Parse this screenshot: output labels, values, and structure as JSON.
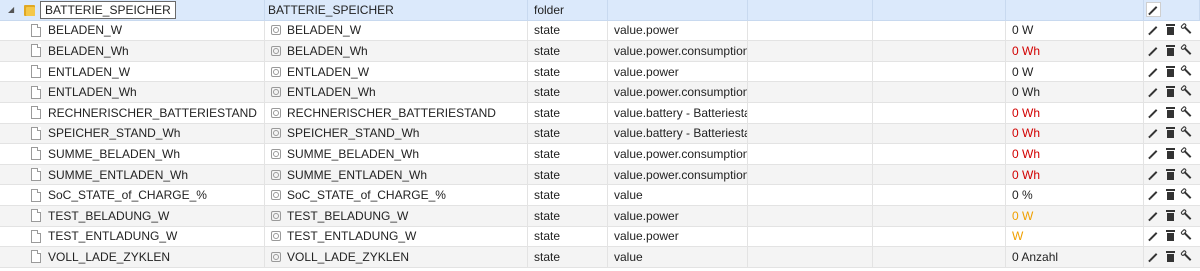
{
  "colors": {
    "selected_row": "#dbe9fb",
    "red_value": "#d20000",
    "orange_value": "#f0a000",
    "normal_value": "#222222"
  },
  "folder": {
    "id": "BATTERIE_SPEICHER",
    "name": "BATTERIE_SPEICHER",
    "type": "folder"
  },
  "rows": [
    {
      "id": "BELADEN_W",
      "name": "BELADEN_W",
      "type": "state",
      "role": "value.power",
      "value": "0 W",
      "value_color": "normal"
    },
    {
      "id": "BELADEN_Wh",
      "name": "BELADEN_Wh",
      "type": "state",
      "role": "value.power.consumption",
      "value": "0 Wh",
      "value_color": "red"
    },
    {
      "id": "ENTLADEN_W",
      "name": "ENTLADEN_W",
      "type": "state",
      "role": "value.power",
      "value": "0 W",
      "value_color": "normal"
    },
    {
      "id": "ENTLADEN_Wh",
      "name": "ENTLADEN_Wh",
      "type": "state",
      "role": "value.power.consumption",
      "value": "0 Wh",
      "value_color": "normal"
    },
    {
      "id": "RECHNERISCHER_BATTERIESTAND",
      "name": "RECHNERISCHER_BATTERIESTAND",
      "type": "state",
      "role": "value.battery - Batteriestar",
      "value": "0 Wh",
      "value_color": "red"
    },
    {
      "id": "SPEICHER_STAND_Wh",
      "name": "SPEICHER_STAND_Wh",
      "type": "state",
      "role": "value.battery - Batteriestar",
      "value": "0 Wh",
      "value_color": "red"
    },
    {
      "id": "SUMME_BELADEN_Wh",
      "name": "SUMME_BELADEN_Wh",
      "type": "state",
      "role": "value.power.consumption",
      "value": "0 Wh",
      "value_color": "red"
    },
    {
      "id": "SUMME_ENTLADEN_Wh",
      "name": "SUMME_ENTLADEN_Wh",
      "type": "state",
      "role": "value.power.consumption",
      "value": "0 Wh",
      "value_color": "red"
    },
    {
      "id": "SoC_STATE_of_CHARGE_%",
      "name": "SoC_STATE_of_CHARGE_%",
      "type": "state",
      "role": "value",
      "value": "0 %",
      "value_color": "normal"
    },
    {
      "id": "TEST_BELADUNG_W",
      "name": "TEST_BELADUNG_W",
      "type": "state",
      "role": "value.power",
      "value": "0 W",
      "value_color": "orange"
    },
    {
      "id": "TEST_ENTLADUNG_W",
      "name": "TEST_ENTLADUNG_W",
      "type": "state",
      "role": "value.power",
      "value": "W",
      "value_color": "orange"
    },
    {
      "id": "VOLL_LADE_ZYKLEN",
      "name": "VOLL_LADE_ZYKLEN",
      "type": "state",
      "role": "value",
      "value": "0 Anzahl",
      "value_color": "normal"
    }
  ],
  "icons": {
    "expander": "expand-triangle-icon",
    "folder": "folder-icon",
    "state": "file-icon",
    "name_marker": "object-icon",
    "edit": "pencil-icon",
    "delete": "trash-icon",
    "settings": "wrench-icon"
  }
}
